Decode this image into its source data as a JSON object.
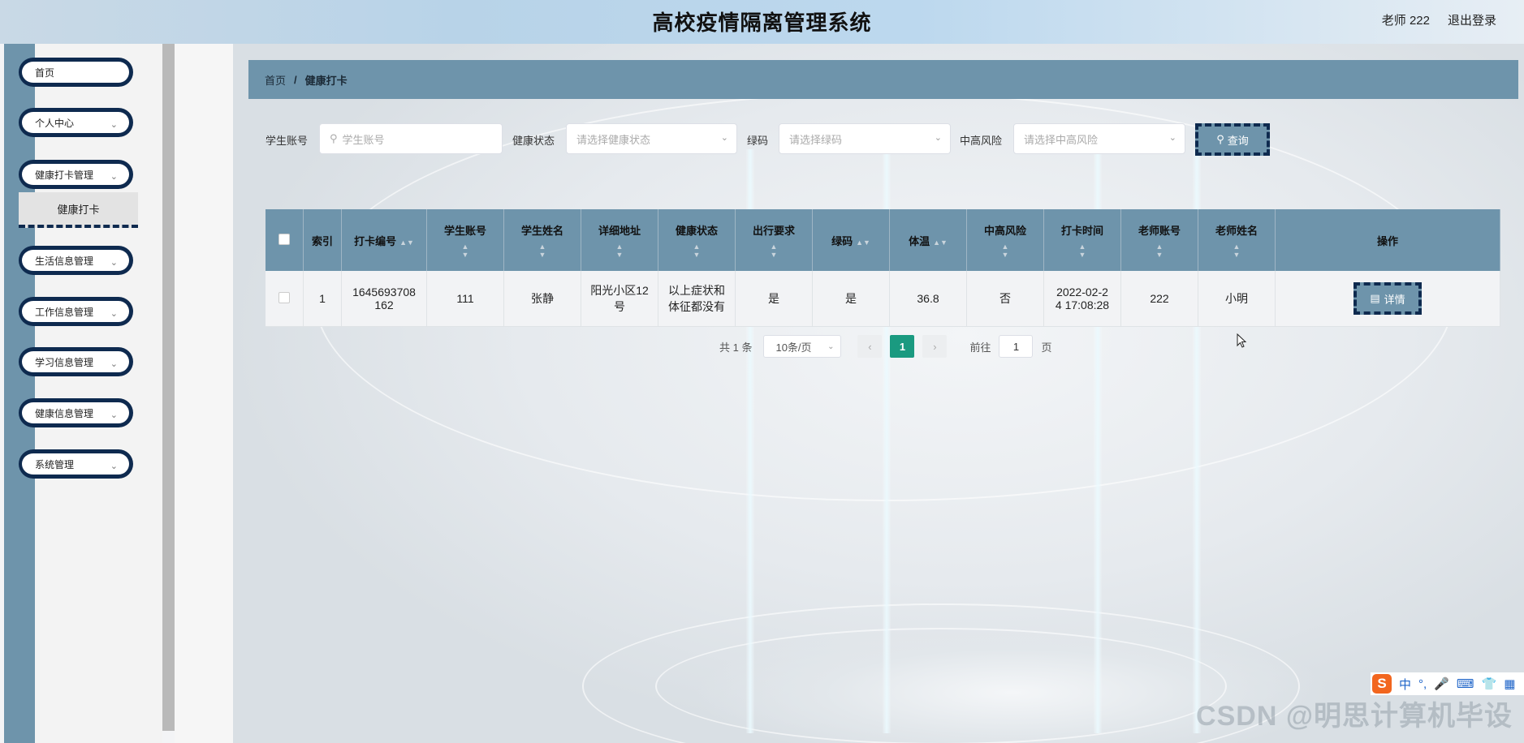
{
  "header": {
    "title": "高校疫情隔离管理系统",
    "user_label": "老师 222",
    "logout_label": "退出登录"
  },
  "sidebar": {
    "items": [
      {
        "label": "首页",
        "has_children": false
      },
      {
        "label": "个人中心",
        "has_children": true
      },
      {
        "label": "健康打卡管理",
        "has_children": true
      },
      {
        "label": "生活信息管理",
        "has_children": true
      },
      {
        "label": "工作信息管理",
        "has_children": true
      },
      {
        "label": "学习信息管理",
        "has_children": true
      },
      {
        "label": "健康信息管理",
        "has_children": true
      },
      {
        "label": "系统管理",
        "has_children": true
      }
    ],
    "active_subitem": "健康打卡"
  },
  "breadcrumb": {
    "home": "首页",
    "separator": "/",
    "current": "健康打卡"
  },
  "filters": {
    "student_account": {
      "label": "学生账号",
      "placeholder": "学生账号"
    },
    "health_status": {
      "label": "健康状态",
      "placeholder": "请选择健康状态"
    },
    "green_code": {
      "label": "绿码",
      "placeholder": "请选择绿码"
    },
    "risk": {
      "label": "中高风险",
      "placeholder": "请选择中高风险"
    },
    "search_label": "查询"
  },
  "table": {
    "columns": [
      "索引",
      "打卡编号",
      "学生账号",
      "学生姓名",
      "详细地址",
      "健康状态",
      "出行要求",
      "绿码",
      "体温",
      "中高风险",
      "打卡时间",
      "老师账号",
      "老师姓名",
      "操作"
    ],
    "rows": [
      {
        "index": "1",
        "record_no_line1": "1645693708",
        "record_no_line2": "162",
        "student_account": "111",
        "student_name": "张静",
        "address_line1": "阳光小区12",
        "address_line2": "号",
        "health_line1": "以上症状和",
        "health_line2": "体征都没有",
        "travel": "是",
        "green_code": "是",
        "temperature": "36.8",
        "risk": "否",
        "time_line1": "2022-02-2",
        "time_line2": "4 17:08:28",
        "teacher_account": "222",
        "teacher_name": "小明",
        "action_label": "详情"
      }
    ]
  },
  "pagination": {
    "total": "共 1 条",
    "page_size": "10条/页",
    "current_page": "1",
    "goto_label": "前往",
    "goto_value": "1",
    "page_suffix": "页"
  },
  "ime": {
    "logo": "S",
    "mode": "中"
  },
  "watermark": "CSDN @明思计算机毕设",
  "colors": {
    "accent": "#6e94ab",
    "dark": "#0e2a4f",
    "active_page": "#1a9a80"
  }
}
